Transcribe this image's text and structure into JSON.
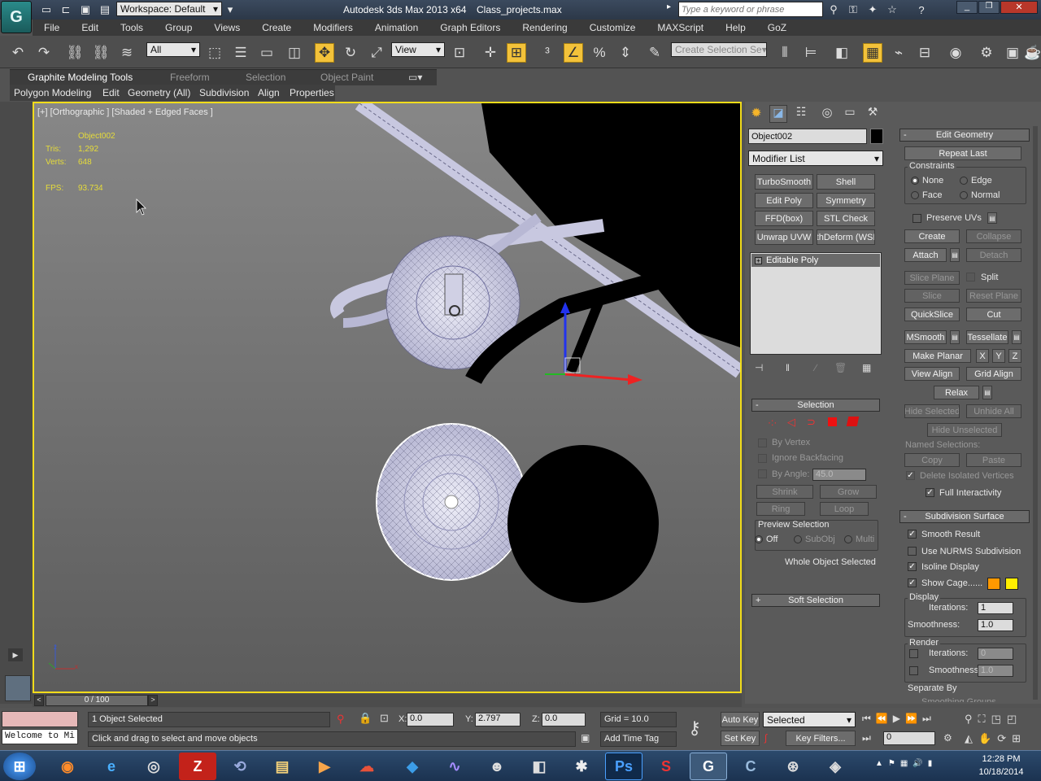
{
  "app": {
    "workspace": "Workspace: Default",
    "title": "Autodesk 3ds Max 2013 x64",
    "file": "Class_projects.max",
    "search_placeholder": "Type a keyword or phrase"
  },
  "menu": [
    "File",
    "Edit",
    "Tools",
    "Group",
    "Views",
    "Create",
    "Modifiers",
    "Animation",
    "Graph Editors",
    "Rendering",
    "Customize",
    "MAXScript",
    "Help",
    "GoZ"
  ],
  "toolbar": {
    "filter": "All",
    "ref_coord": "View",
    "selection_set": "Create Selection Se"
  },
  "ribbon": {
    "tabs": [
      "Graphite Modeling Tools",
      "Freeform",
      "Selection",
      "Object Paint"
    ],
    "subtabs": [
      "Polygon Modeling",
      "Edit",
      "Geometry (All)",
      "Subdivision",
      "Align",
      "Properties"
    ]
  },
  "viewport": {
    "label": "[+] [Orthographic ] [Shaded + Edged Faces ]",
    "object": "Object002",
    "tris_label": "Tris:",
    "tris": "1,292",
    "verts_label": "Verts:",
    "verts": "648",
    "fps_label": "FPS:",
    "fps": "93.734"
  },
  "modify": {
    "name": "Object002",
    "modifier_list": "Modifier List",
    "mod_buttons": [
      "TurboSmooth",
      "Shell",
      "Edit Poly",
      "Symmetry",
      "FFD(box)",
      "STL Check",
      "Unwrap UVW",
      "thDeform (WSI"
    ],
    "stack_item": "Editable Poly"
  },
  "selection": {
    "title": "Selection",
    "by_vertex": "By Vertex",
    "ignore_backfacing": "Ignore Backfacing",
    "by_angle": "By Angle:",
    "angle": "45.0",
    "shrink": "Shrink",
    "grow": "Grow",
    "ring": "Ring",
    "loop": "Loop",
    "preview": "Preview Selection",
    "off": "Off",
    "subobj": "SubObj",
    "multi": "Multi",
    "status": "Whole Object Selected",
    "soft": "Soft Selection"
  },
  "edit_geometry": {
    "title": "Edit Geometry",
    "repeat_last": "Repeat Last",
    "constraints": "Constraints",
    "none": "None",
    "edge": "Edge",
    "face": "Face",
    "normal": "Normal",
    "preserve_uvs": "Preserve UVs",
    "create": "Create",
    "collapse": "Collapse",
    "attach": "Attach",
    "detach": "Detach",
    "slice_plane": "Slice Plane",
    "split": "Split",
    "slice": "Slice",
    "reset_plane": "Reset Plane",
    "quickslice": "QuickSlice",
    "cut": "Cut",
    "msmooth": "MSmooth",
    "tessellate": "Tessellate",
    "make_planar": "Make Planar",
    "x": "X",
    "y": "Y",
    "z": "Z",
    "view_align": "View Align",
    "grid_align": "Grid Align",
    "relax": "Relax",
    "hide_selected": "Hide Selected",
    "unhide_all": "Unhide All",
    "hide_unselected": "Hide Unselected",
    "named_selections": "Named Selections:",
    "copy": "Copy",
    "paste": "Paste",
    "delete_isolated": "Delete Isolated Vertices",
    "full_interactivity": "Full Interactivity"
  },
  "subdivision": {
    "title": "Subdivision Surface",
    "smooth_result": "Smooth Result",
    "use_nurms": "Use NURMS Subdivision",
    "isoline": "Isoline Display",
    "show_cage": "Show Cage......",
    "display": "Display",
    "iterations_label": "Iterations:",
    "iterations": "1",
    "smoothness_label": "Smoothness:",
    "smoothness": "1.0",
    "render": "Render",
    "r_iterations": "0",
    "r_smoothness": "1.0",
    "separate_by": "Separate By",
    "smoothing_groups": "Smoothing Groups",
    "cage_color1": "#ff9900",
    "cage_color2": "#ffee00"
  },
  "timeline": {
    "frame": "0 / 100"
  },
  "status": {
    "selected": "1 Object Selected",
    "prompt": "Click and drag to select and move objects",
    "x_label": "X:",
    "x": "0.0",
    "y_label": "Y:",
    "y": "2.797",
    "z_label": "Z:",
    "z": "0.0",
    "grid": "Grid = 10.0",
    "add_time_tag": "Add Time Tag",
    "auto_key": "Auto Key",
    "set_key": "Set Key",
    "key_mode": "Selected",
    "key_filters": "Key Filters...",
    "frame": "0",
    "maxscript": "Welcome to Mi"
  },
  "taskbar": {
    "time": "12:28 PM",
    "date": "10/18/2014"
  }
}
